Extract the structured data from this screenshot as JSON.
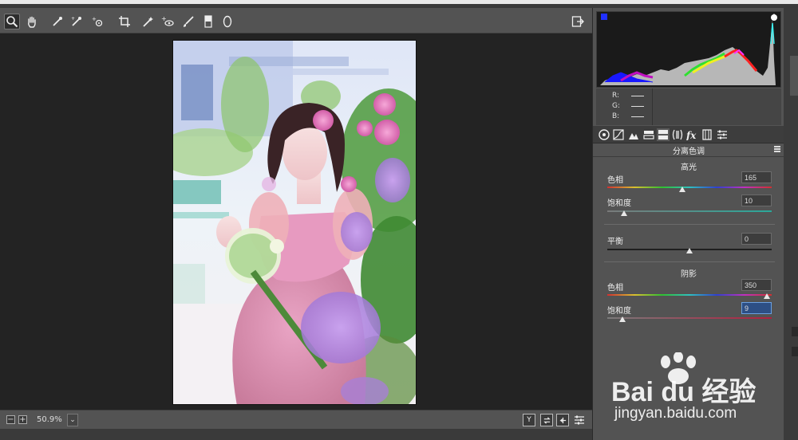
{
  "toolbar": {
    "tools": [
      "zoom-icon",
      "hand-icon",
      "white-balance-icon",
      "color-sampler-icon",
      "targeted-adjust-icon",
      "crop-icon",
      "spot-removal-icon",
      "red-eye-icon",
      "adjustment-brush-icon",
      "graduated-filter-icon",
      "radial-filter-icon",
      "open-preferences-icon"
    ]
  },
  "bottombar": {
    "zoom_out": "−",
    "zoom_in": "+",
    "zoom": "50.9%",
    "dropdown": "⌄",
    "view_y": "Y"
  },
  "rgb": {
    "r_label": "R:",
    "g_label": "G:",
    "b_label": "B:"
  },
  "panel": {
    "title": "分离色调",
    "highlights": {
      "title": "高光",
      "hue_label": "色相",
      "hue_value": "165",
      "hue_fraction": 0.458,
      "saturation_label": "饱和度",
      "saturation_value": "10",
      "saturation_fraction": 0.1
    },
    "balance": {
      "label": "平衡",
      "value": "0",
      "fraction": 0.5
    },
    "shadows": {
      "title": "阴影",
      "hue_label": "色相",
      "hue_value": "350",
      "hue_fraction": 0.972,
      "saturation_label": "饱和度",
      "saturation_value": "9",
      "saturation_fraction": 0.09
    }
  },
  "watermark": {
    "logo": "Bai du 经验",
    "url": "jingyan.baidu.com"
  },
  "colors": {
    "panel_bg": "#535353",
    "canvas_bg": "#232323",
    "focus_blue": "#2d4f85"
  }
}
